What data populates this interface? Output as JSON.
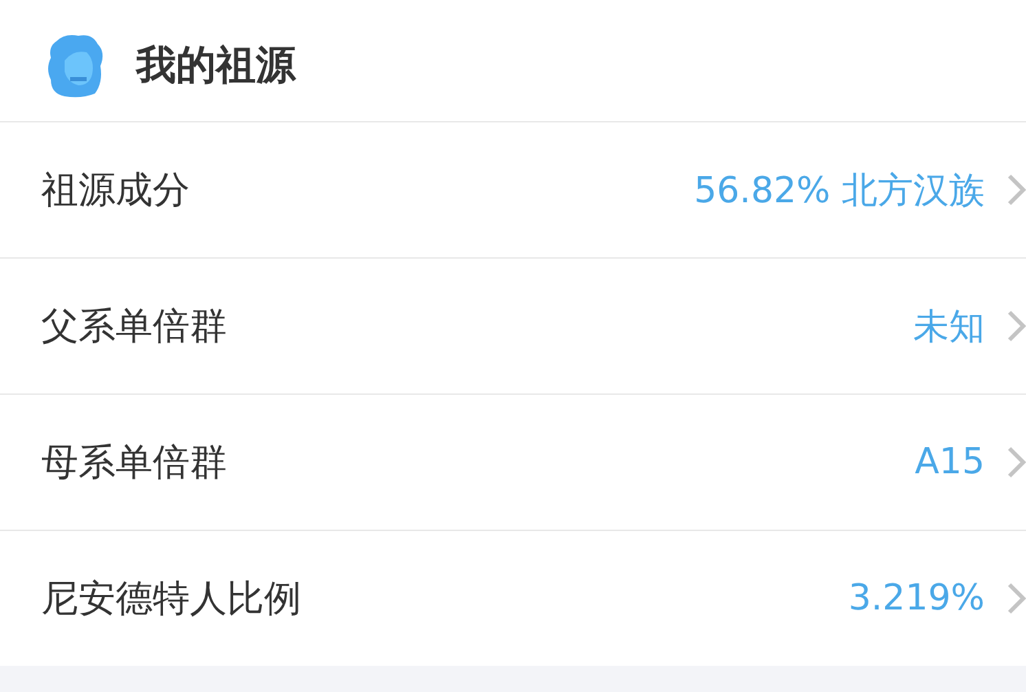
{
  "header": {
    "title": "我的祖源"
  },
  "rows": [
    {
      "label": "祖源成分",
      "value": "56.82% 北方汉族"
    },
    {
      "label": "父系单倍群",
      "value": "未知"
    },
    {
      "label": "母系单倍群",
      "value": "A15"
    },
    {
      "label": "尼安德特人比例",
      "value": "3.219%"
    }
  ]
}
